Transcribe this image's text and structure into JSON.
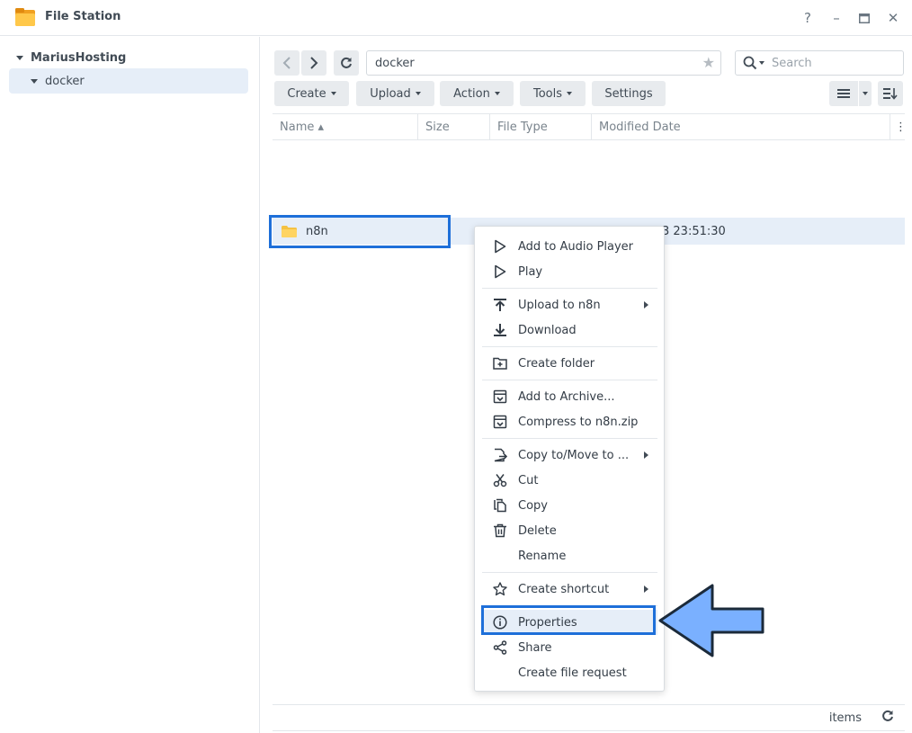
{
  "window": {
    "title": "File Station",
    "help": "?",
    "minimize": "–",
    "close": "✕"
  },
  "sidebar": {
    "root": "MariusHosting",
    "child": "docker"
  },
  "toolbar": {
    "path": "docker",
    "search_placeholder": "Search",
    "buttons": {
      "create": "Create",
      "upload": "Upload",
      "action": "Action",
      "tools": "Tools",
      "settings": "Settings"
    }
  },
  "columns": {
    "name": "Name ▴",
    "size": "Size",
    "type": "File Type",
    "date": "Modified Date"
  },
  "file_row": {
    "name": "n8n",
    "date_partial": "3 23:51:30"
  },
  "footer": {
    "items": "items"
  },
  "context_menu": {
    "add_audio": "Add to Audio Player",
    "play": "Play",
    "upload_to": "Upload to n8n",
    "download": "Download",
    "create_folder": "Create folder",
    "add_archive": "Add to Archive...",
    "compress": "Compress to n8n.zip",
    "copy_move": "Copy to/Move to ...",
    "cut": "Cut",
    "copy": "Copy",
    "delete": "Delete",
    "rename": "Rename",
    "shortcut": "Create shortcut",
    "properties": "Properties",
    "share": "Share",
    "file_request": "Create file request"
  },
  "colors": {
    "highlight_border": "#1e6fd9",
    "arrow_fill": "#7ab0ff",
    "arrow_stroke": "#1b2a3a",
    "selection_bg": "#e6eef8"
  }
}
